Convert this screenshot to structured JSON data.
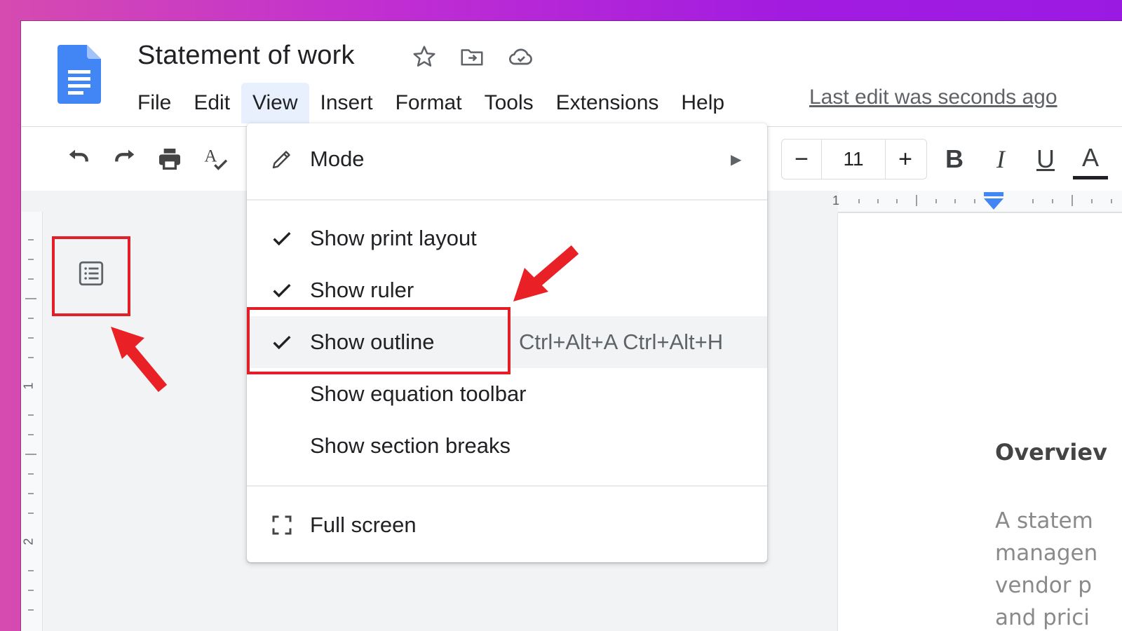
{
  "document": {
    "title": "Statement of work",
    "last_edit": "Last edit was seconds ago"
  },
  "menubar": {
    "items": [
      "File",
      "Edit",
      "View",
      "Insert",
      "Format",
      "Tools",
      "Extensions",
      "Help"
    ],
    "active": "View"
  },
  "toolbar": {
    "font_size": "11",
    "decrease_label": "−",
    "increase_label": "+",
    "bold_label": "B",
    "italic_label": "I",
    "underline_label": "U",
    "text_color_label": "A"
  },
  "view_menu": {
    "items": [
      {
        "label": "Mode",
        "icon": "pencil-icon",
        "has_submenu": true
      },
      {
        "label": "Show print layout",
        "checked": true
      },
      {
        "label": "Show ruler",
        "checked": true
      },
      {
        "label": "Show outline",
        "checked": true,
        "shortcut": "Ctrl+Alt+A Ctrl+Alt+H",
        "highlighted": true
      },
      {
        "label": "Show equation toolbar",
        "checked": false
      },
      {
        "label": "Show section breaks",
        "checked": false
      },
      {
        "label": "Full screen",
        "icon": "fullscreen-icon"
      }
    ],
    "submenu_arrow": "▶"
  },
  "rulers": {
    "horizontal_label": "1",
    "vertical_labels": [
      "1",
      "2"
    ]
  },
  "page_content": {
    "heading": "Overviev",
    "body_lines": [
      "A statem",
      "managen",
      "vendor p",
      "and prici"
    ]
  },
  "colors": {
    "annotation_red": "#e21f27",
    "docs_blue": "#4285f4",
    "menu_hover": "#f1f3f4",
    "active_menu": "#e8f0fe"
  }
}
